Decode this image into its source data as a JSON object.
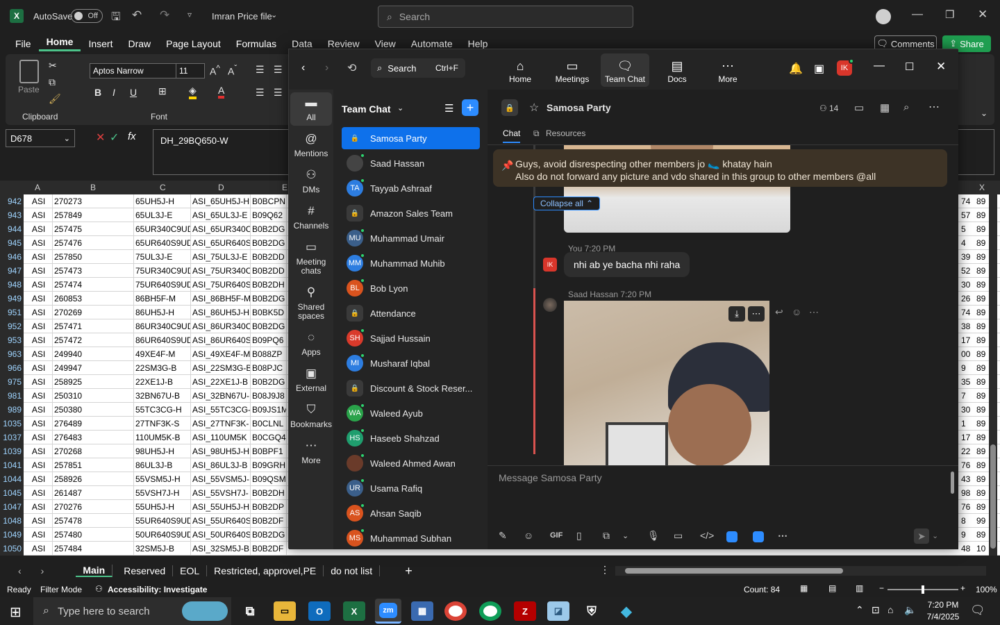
{
  "excel": {
    "autosave": "AutoSave",
    "autosave_state": "Off",
    "file_title": "Imran Price file",
    "search_placeholder": "Search",
    "menu": [
      "File",
      "Home",
      "Insert",
      "Draw",
      "Page Layout",
      "Formulas",
      "Data",
      "Review",
      "View",
      "Automate",
      "Help"
    ],
    "comments_label": "Comments",
    "share_label": "Share",
    "ribbon": {
      "paste": "Paste",
      "clipboard": "Clipboard",
      "font_group": "Font",
      "font_name": "Aptos Narrow",
      "font_size": "11",
      "bold": "B",
      "italic": "I",
      "underline": "U"
    },
    "name_box": "D678",
    "formula": "DH_29BQ650-W",
    "columns": [
      "A",
      "B",
      "C",
      "D",
      "E",
      "X"
    ],
    "rows": [
      [
        "942",
        "ASI",
        "270273",
        "65UH5J-H",
        "ASI_65UH5J-H",
        "B0BCPN",
        "74",
        "89"
      ],
      [
        "943",
        "ASI",
        "257849",
        "65UL3J-E",
        "ASI_65UL3J-E",
        "B09Q62",
        "57",
        "89"
      ],
      [
        "944",
        "ASI",
        "257475",
        "65UR340C9UD",
        "ASI_65UR340C",
        "B0B2DG",
        "5",
        "89"
      ],
      [
        "945",
        "ASI",
        "257476",
        "65UR640S9UD",
        "ASI_65UR640S",
        "B0B2DG",
        "4",
        "89"
      ],
      [
        "946",
        "ASI",
        "257850",
        "75UL3J-E",
        "ASI_75UL3J-E",
        "B0B2DD",
        "39",
        "89"
      ],
      [
        "947",
        "ASI",
        "257473",
        "75UR340C9UD",
        "ASI_75UR340C",
        "B0B2DD",
        "52",
        "89"
      ],
      [
        "948",
        "ASI",
        "257474",
        "75UR640S9UD",
        "ASI_75UR640S",
        "B0B2DH",
        "30",
        "89"
      ],
      [
        "949",
        "ASI",
        "260853",
        "86BH5F-M",
        "ASI_86BH5F-M",
        "B0B2DG",
        "26",
        "89"
      ],
      [
        "951",
        "ASI",
        "270269",
        "86UH5J-H",
        "ASI_86UH5J-H",
        "B0BK5D",
        "74",
        "89"
      ],
      [
        "952",
        "ASI",
        "257471",
        "86UR340C9UD",
        "ASI_86UR340C",
        "B0B2DG",
        "38",
        "89"
      ],
      [
        "953",
        "ASI",
        "257472",
        "86UR640S9UD",
        "ASI_86UR640S",
        "B09PQ6",
        "17",
        "89"
      ],
      [
        "963",
        "ASI",
        "249940",
        "49XE4F-M",
        "ASI_49XE4F-M",
        "B088ZP",
        "00",
        "89"
      ],
      [
        "966",
        "ASI",
        "249947",
        "22SM3G-B",
        "ASI_22SM3G-B",
        "B08PJC",
        "9",
        "89"
      ],
      [
        "975",
        "ASI",
        "258925",
        "22XE1J-B",
        "ASI_22XE1J-B",
        "B0B2DG",
        "35",
        "89"
      ],
      [
        "981",
        "ASI",
        "250310",
        "32BN67U-B",
        "ASI_32BN67U-",
        "B08J9J8",
        "7",
        "89"
      ],
      [
        "989",
        "ASI",
        "250380",
        "55TC3CG-H",
        "ASI_55TC3CG-",
        "B09JS1M",
        "30",
        "89"
      ],
      [
        "1035",
        "ASI",
        "276489",
        "27TNF3K-S",
        "ASI_27TNF3K-",
        "B0CLNL",
        "1",
        "89"
      ],
      [
        "1037",
        "ASI",
        "276483",
        "110UM5K-B",
        "ASI_110UM5K",
        "B0CGQ4",
        "17",
        "89"
      ],
      [
        "1039",
        "ASI",
        "270268",
        "98UH5J-H",
        "ASI_98UH5J-H",
        "B0BPF1",
        "22",
        "89"
      ],
      [
        "1041",
        "ASI",
        "257851",
        "86UL3J-B",
        "ASI_86UL3J-B",
        "B09GRH",
        "76",
        "89"
      ],
      [
        "1044",
        "ASI",
        "258926",
        "55VSM5J-H",
        "ASI_55VSM5J-",
        "B09QSM",
        "43",
        "89"
      ],
      [
        "1045",
        "ASI",
        "261487",
        "55VSH7J-H",
        "ASI_55VSH7J-",
        "B0B2DH",
        "98",
        "89"
      ],
      [
        "1047",
        "ASI",
        "270276",
        "55UH5J-H",
        "ASI_55UH5J-H",
        "B0B2DP",
        "76",
        "89"
      ],
      [
        "1048",
        "ASI",
        "257478",
        "55UR640S9UD",
        "ASI_55UR640S",
        "B0B2DF",
        "8",
        "99"
      ],
      [
        "1049",
        "ASI",
        "257480",
        "50UR640S9UD",
        "ASI_50UR640S",
        "B0B2DG",
        "9",
        "89"
      ],
      [
        "1050",
        "ASI",
        "257484",
        "32SM5J-B",
        "ASI_32SM5J-B",
        "B0B2DF",
        "48",
        "10"
      ]
    ],
    "sheet_tabs": [
      "Main",
      "Reserved",
      "EOL",
      "Restricted, approvel,PE",
      "do not list"
    ],
    "status": {
      "ready": "Ready",
      "filter": "Filter Mode",
      "accessibility": "Accessibility: Investigate",
      "count": "Count: 84",
      "zoom": "100%"
    }
  },
  "zoom": {
    "search_label": "Search",
    "search_shortcut": "Ctrl+F",
    "nav": [
      {
        "label": "Home",
        "icon": "home-icon"
      },
      {
        "label": "Meetings",
        "icon": "video-icon"
      },
      {
        "label": "Team Chat",
        "icon": "chat-icon"
      },
      {
        "label": "Docs",
        "icon": "doc-icon"
      },
      {
        "label": "More",
        "icon": "more-icon"
      }
    ],
    "avatar_initials": "IK",
    "rail": [
      {
        "label": "All",
        "icon": "chat-bubble-icon"
      },
      {
        "label": "Mentions",
        "icon": "at-icon"
      },
      {
        "label": "DMs",
        "icon": "people-icon"
      },
      {
        "label": "Channels",
        "icon": "hash-icon"
      },
      {
        "label": "Meeting chats",
        "icon": "calendar-icon"
      },
      {
        "label": "Shared spaces",
        "icon": "share-icon"
      },
      {
        "label": "Apps",
        "icon": "apps-icon"
      },
      {
        "label": "External",
        "icon": "external-icon"
      },
      {
        "label": "Bookmarks",
        "icon": "bookmark-icon"
      },
      {
        "label": "More",
        "icon": "more-icon"
      }
    ],
    "list_title": "Team Chat",
    "chats": [
      {
        "name": "Samosa Party",
        "type": "lock",
        "selected": true
      },
      {
        "name": "Saad Hassan",
        "initials": "",
        "color": "#444"
      },
      {
        "name": "Tayyab Ashraaf",
        "initials": "TA",
        "color": "#2d7de0"
      },
      {
        "name": "Amazon Sales Team",
        "type": "lock"
      },
      {
        "name": "Muhammad Umair",
        "initials": "MU",
        "color": "#3b5f8a"
      },
      {
        "name": "Muhammad Muhib",
        "initials": "MM",
        "color": "#2d7de0"
      },
      {
        "name": "Bob Lyon",
        "initials": "BL",
        "color": "#d9531e"
      },
      {
        "name": "Attendance",
        "type": "lock"
      },
      {
        "name": "Sajjad Hussain",
        "initials": "SH",
        "color": "#d93a2b"
      },
      {
        "name": "Musharaf Iqbal",
        "initials": "MI",
        "color": "#2d7de0"
      },
      {
        "name": "Discount & Stock Reser...",
        "type": "lock"
      },
      {
        "name": "Waleed Ayub",
        "initials": "WA",
        "color": "#2aa34a"
      },
      {
        "name": "Haseeb Shahzad",
        "initials": "HS",
        "color": "#1f9e6e"
      },
      {
        "name": "Waleed Ahmed Awan",
        "initials": "",
        "color": "#6a3b2a"
      },
      {
        "name": "Usama Rafiq",
        "initials": "UR",
        "color": "#3b5f8a"
      },
      {
        "name": "Ahsan Saqib",
        "initials": "AS",
        "color": "#d9531e"
      },
      {
        "name": "Muhammad Subhan",
        "initials": "MS",
        "color": "#d9531e"
      }
    ],
    "channel_name": "Samosa Party",
    "member_count": "14",
    "tabs": [
      "Chat",
      "Resources"
    ],
    "pinned_line1": "Guys, avoid disrespecting other members jo 🥿 khatay hain",
    "pinned_line2": "Also do not forward any picture and vdo shared in this group to other members @all",
    "collapse_label": "Collapse all",
    "msg1_meta": "You 7:20 PM",
    "msg1_text": "nhi ab ye bacha nhi raha",
    "msg2_meta": "Saad Hassan 7:20 PM",
    "composer_placeholder": "Message Samosa Party",
    "composer_gif": "GIF"
  },
  "taskbar": {
    "search_placeholder": "Type here to search",
    "time": "7:20 PM",
    "date": "7/4/2025"
  }
}
